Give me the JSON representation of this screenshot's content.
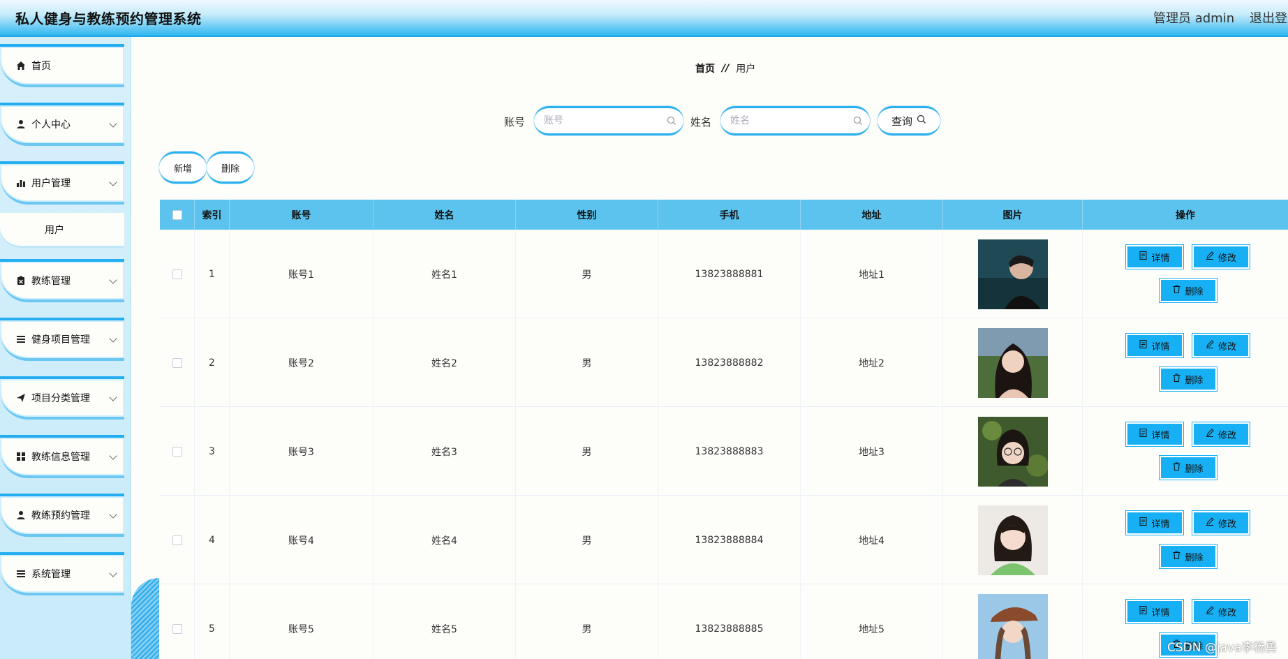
{
  "header": {
    "title": "私人健身与教练预约管理系统",
    "admin": "管理员 admin",
    "logout": "退出登"
  },
  "sidebar": {
    "items": [
      {
        "label": "首页",
        "icon": "home-icon"
      },
      {
        "label": "个人中心",
        "icon": "user-icon"
      },
      {
        "label": "用户管理",
        "icon": "bar-chart-icon"
      },
      {
        "label": "教练管理",
        "icon": "clipboard-icon"
      },
      {
        "label": "健身项目管理",
        "icon": "list-icon"
      },
      {
        "label": "项目分类管理",
        "icon": "send-icon"
      },
      {
        "label": "教练信息管理",
        "icon": "grid-icon"
      },
      {
        "label": "教练预约管理",
        "icon": "user-icon"
      },
      {
        "label": "系统管理",
        "icon": "list-icon"
      }
    ],
    "sub_item": "用户"
  },
  "breadcrumb": {
    "home": "首页",
    "separator": "//",
    "current": "用户"
  },
  "search": {
    "account_label": "账号",
    "account_placeholder": "账号",
    "name_label": "姓名",
    "name_placeholder": "姓名",
    "query_label": "查询"
  },
  "actions": {
    "add": "新增",
    "delete": "删除"
  },
  "table": {
    "headers": [
      "索引",
      "账号",
      "姓名",
      "性别",
      "手机",
      "地址",
      "图片",
      "操作"
    ],
    "rows": [
      {
        "index": "1",
        "account": "账号1",
        "name": "姓名1",
        "gender": "男",
        "phone": "13823888881",
        "address": "地址1"
      },
      {
        "index": "2",
        "account": "账号2",
        "name": "姓名2",
        "gender": "男",
        "phone": "13823888882",
        "address": "地址2"
      },
      {
        "index": "3",
        "account": "账号3",
        "name": "姓名3",
        "gender": "男",
        "phone": "13823888883",
        "address": "地址3"
      },
      {
        "index": "4",
        "account": "账号4",
        "name": "姓名4",
        "gender": "男",
        "phone": "13823888884",
        "address": "地址4"
      },
      {
        "index": "5",
        "account": "账号5",
        "name": "姓名5",
        "gender": "男",
        "phone": "13823888885",
        "address": "地址5"
      }
    ],
    "op_labels": {
      "detail": "详情",
      "edit": "修改",
      "delete": "删除"
    }
  },
  "watermark": "CSDN @java李杨勇",
  "colors": {
    "accent": "#17b0f5",
    "header_row": "#5cc3ee"
  }
}
